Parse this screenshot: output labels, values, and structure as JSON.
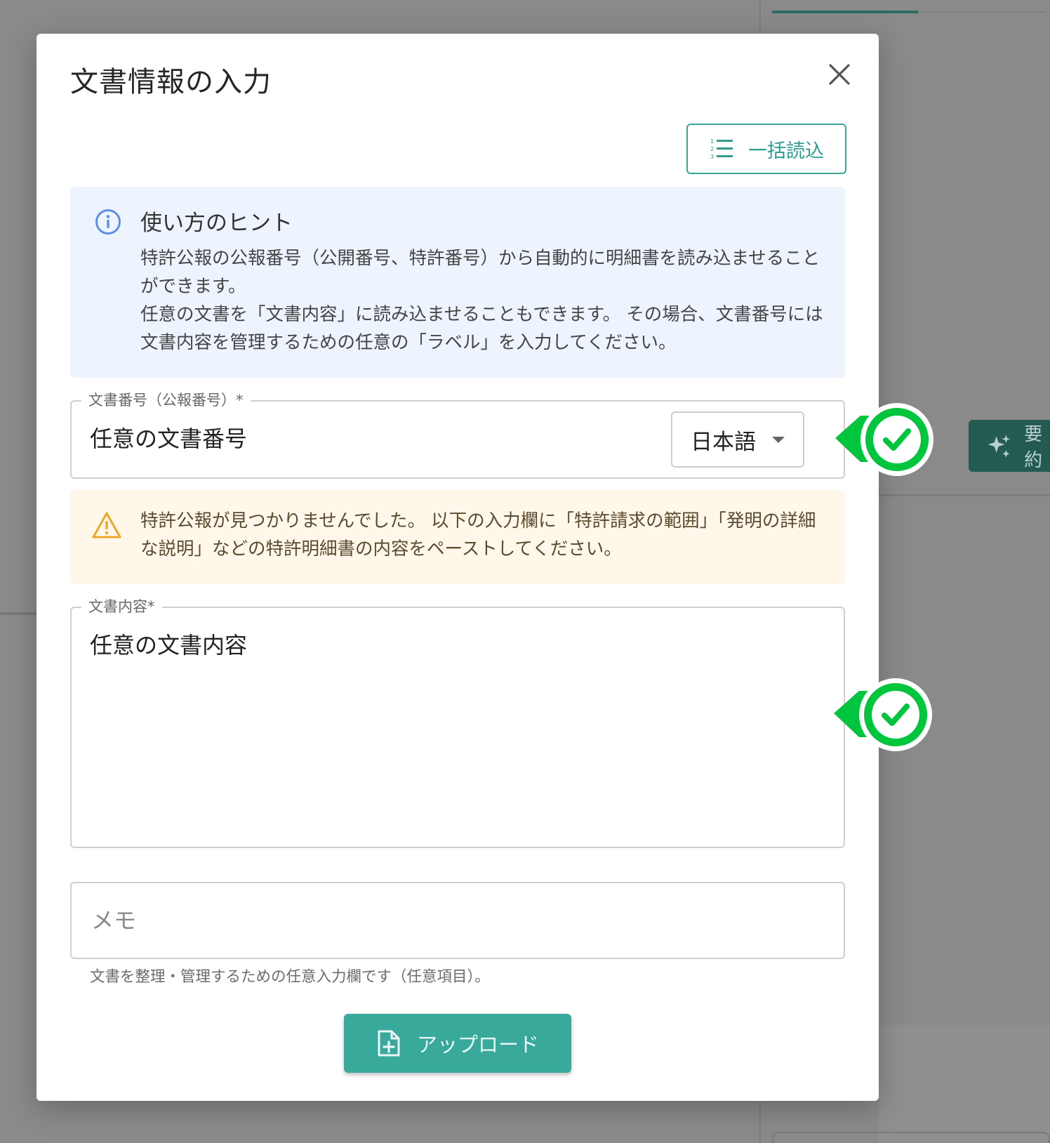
{
  "dialog": {
    "title": "文書情報の入力",
    "bulk_load_label": "一括読込",
    "hint": {
      "title": "使い方のヒント",
      "lines": [
        "特許公報の公報番号（公開番号、特許番号）から自動的に明細書を読み込ませることができます。",
        "任意の文書を「文書内容」に読み込ませることもできます。 その場合、文書番号には文書内容を管理するための任意の「ラベル」を入力してください。"
      ]
    },
    "doc_number": {
      "label": "文書番号（公報番号）*",
      "value": "任意の文書番号",
      "language": "日本語"
    },
    "warning": "特許公報が見つかりませんでした。 以下の入力欄に「特許請求の範囲」「発明の詳細な説明」などの特許明細書の内容をペーストしてください。",
    "doc_content": {
      "label": "文書内容*",
      "value": "任意の文書内容"
    },
    "memo": {
      "placeholder": "メモ",
      "value": "",
      "help": "文書を整理・管理するための任意入力欄です（任意項目）。"
    },
    "upload_label": "アップロード"
  },
  "background": {
    "summarize_label": "要約"
  },
  "colors": {
    "accent": "#38a99a",
    "accent_dark": "#235b53",
    "hint_bg": "#eef4fd",
    "warn_bg": "#fef7ea",
    "check_green": "#00c53d"
  },
  "icons": {
    "close": "close-icon",
    "bulk": "numbered-list-icon",
    "hint": "info-icon",
    "warning": "warning-icon",
    "upload": "file-add-icon",
    "check": "check-icon",
    "sparkle": "sparkle-icon"
  }
}
